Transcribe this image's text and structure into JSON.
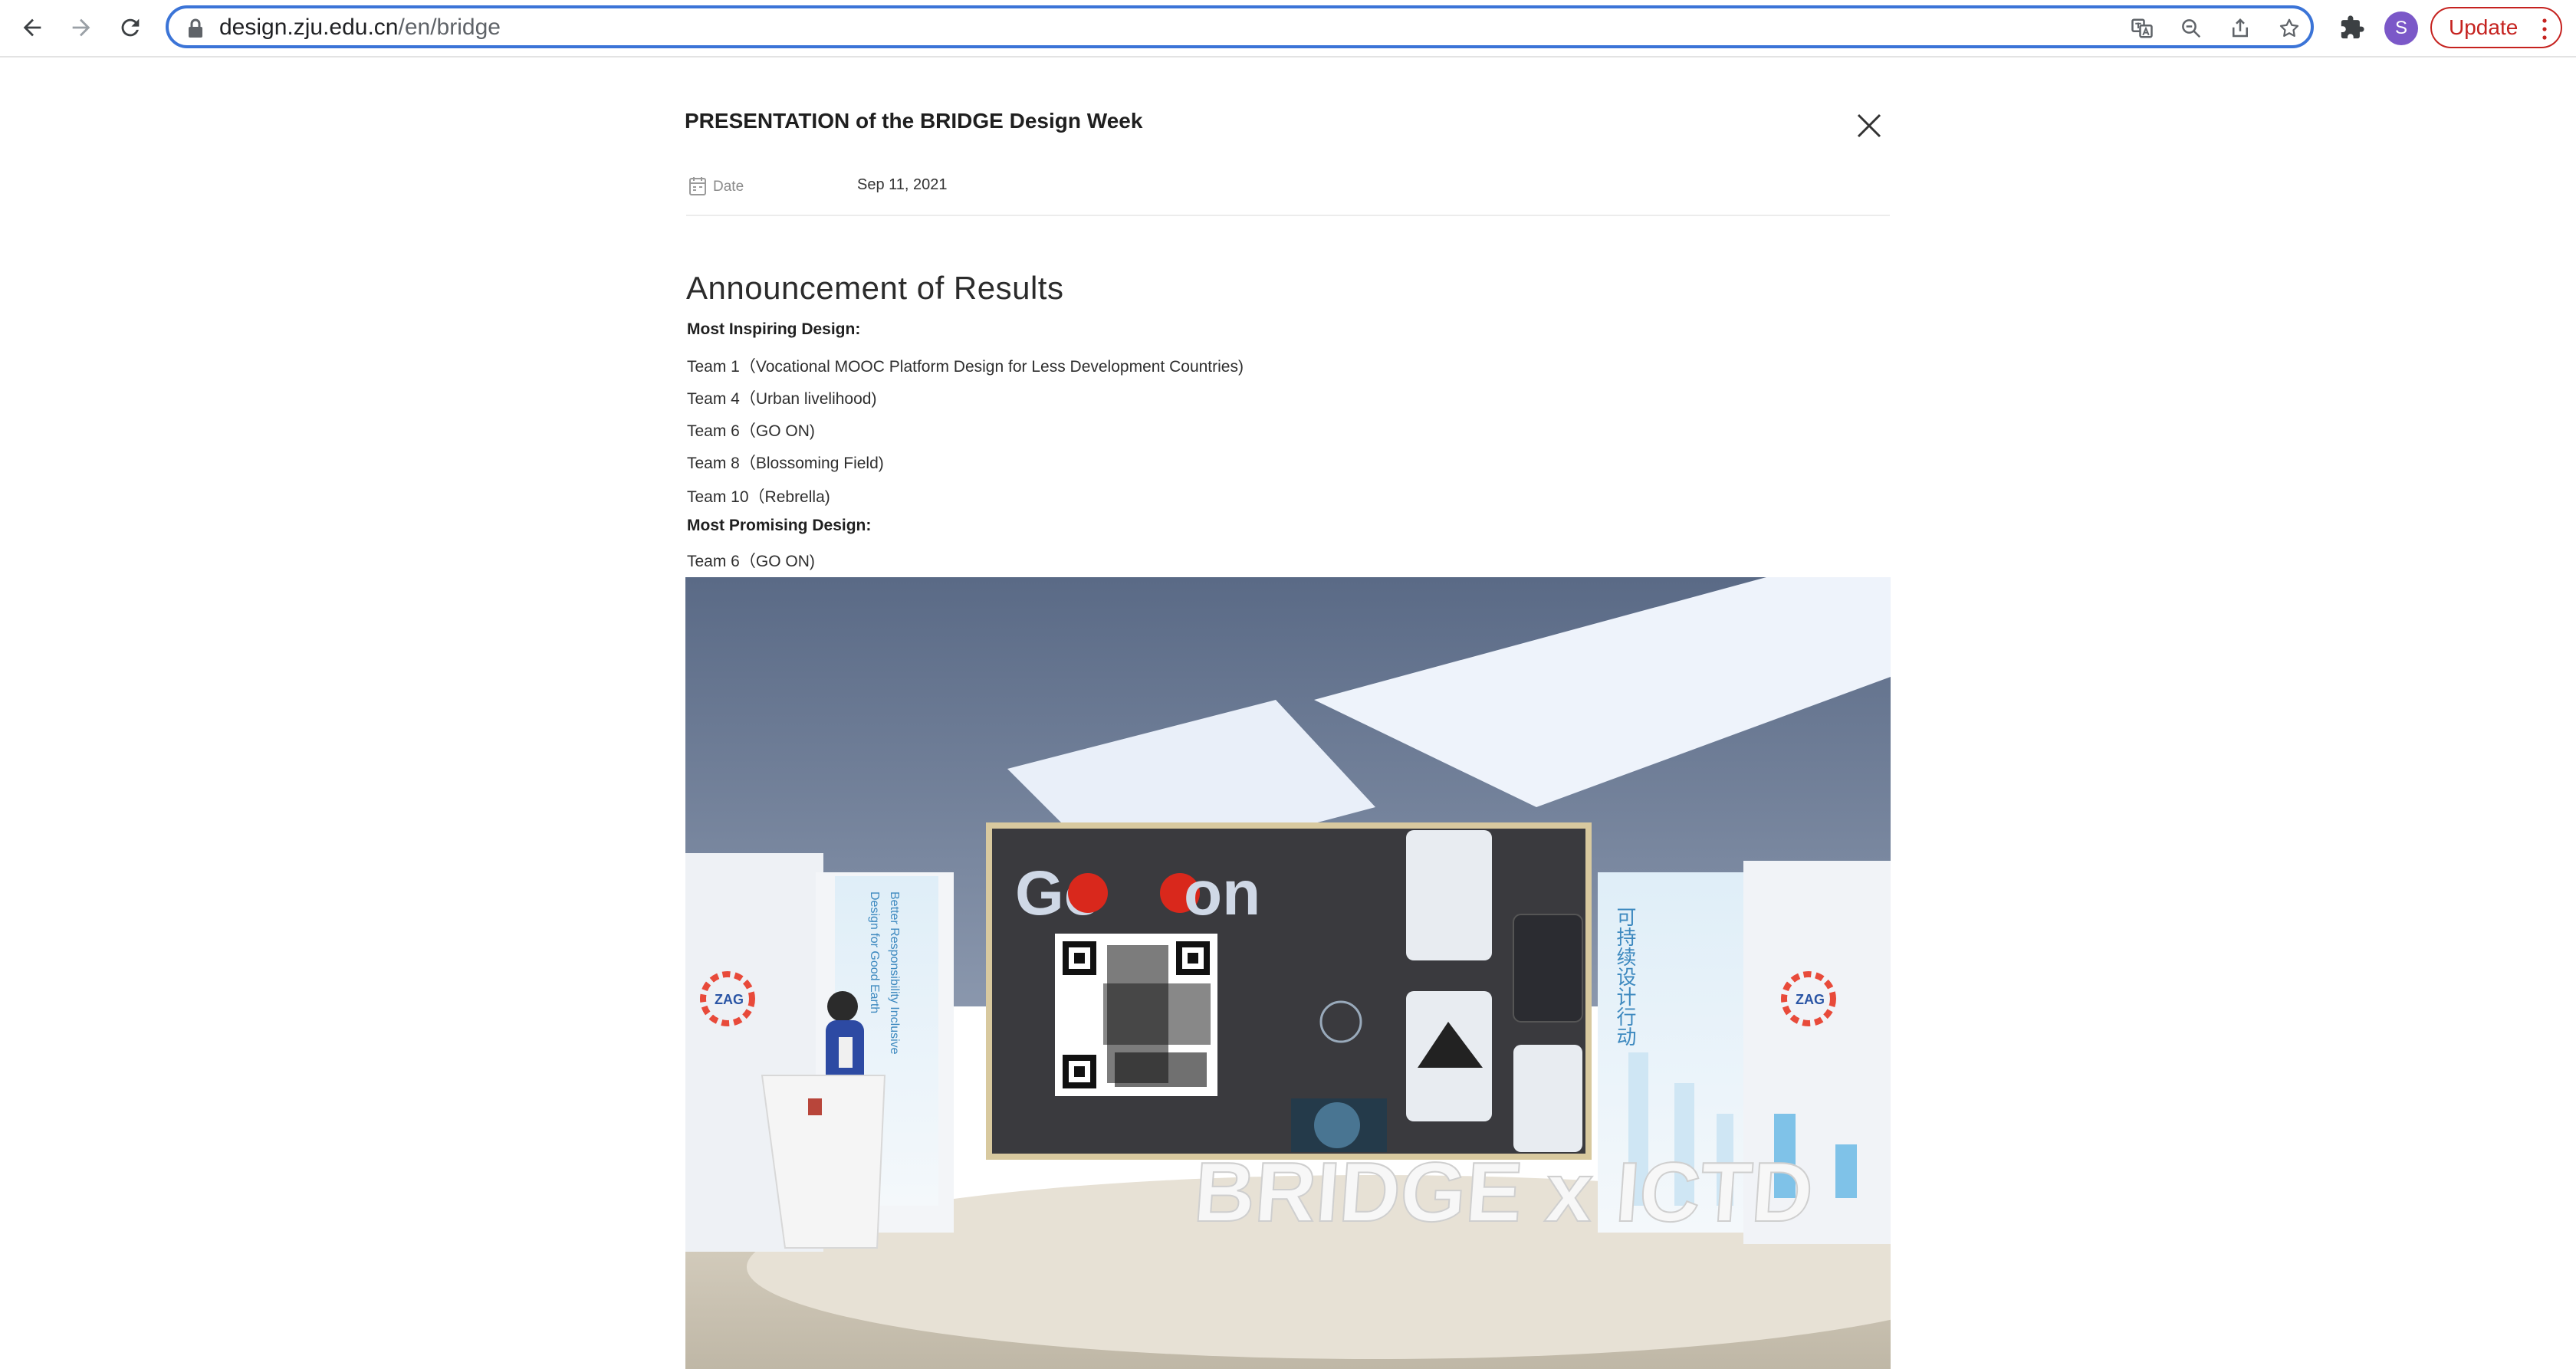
{
  "browser": {
    "url_host": "design.zju.edu.cn",
    "url_path": "/en/bridge",
    "avatar_letter": "S",
    "update_label": "Update"
  },
  "page": {
    "title": "PRESENTATION of the BRIDGE Design Week",
    "date_label": "Date",
    "date_value": "Sep 11, 2021",
    "heading": "Announcement of Results",
    "lines": [
      "Most Inspiring Design:",
      "Team 1（Vocational MOOC Platform Design for Less Development Countries)",
      "Team 4（Urban livelihood)",
      "Team 6（GO ON)",
      "Team 8（Blossoming Field)",
      "Team 10（Rebrella)",
      "Most Promising Design:",
      "Team 6（GO ON)"
    ]
  },
  "photo": {
    "screen_wordmark_1": "Go",
    "screen_wordmark_2": "on",
    "banner_left_line1": "Better Responsibility Inclusive",
    "banner_left_line2": "Design for Good Earth",
    "banner_right_vertical": "可持续设计行动",
    "logo_text": "ZAG",
    "floor_text": "BRIDGE x ICTD"
  },
  "colors": {
    "omnibox_border": "#3b74d7",
    "update_red": "#c5221f",
    "avatar_purple": "#7b58c8"
  }
}
